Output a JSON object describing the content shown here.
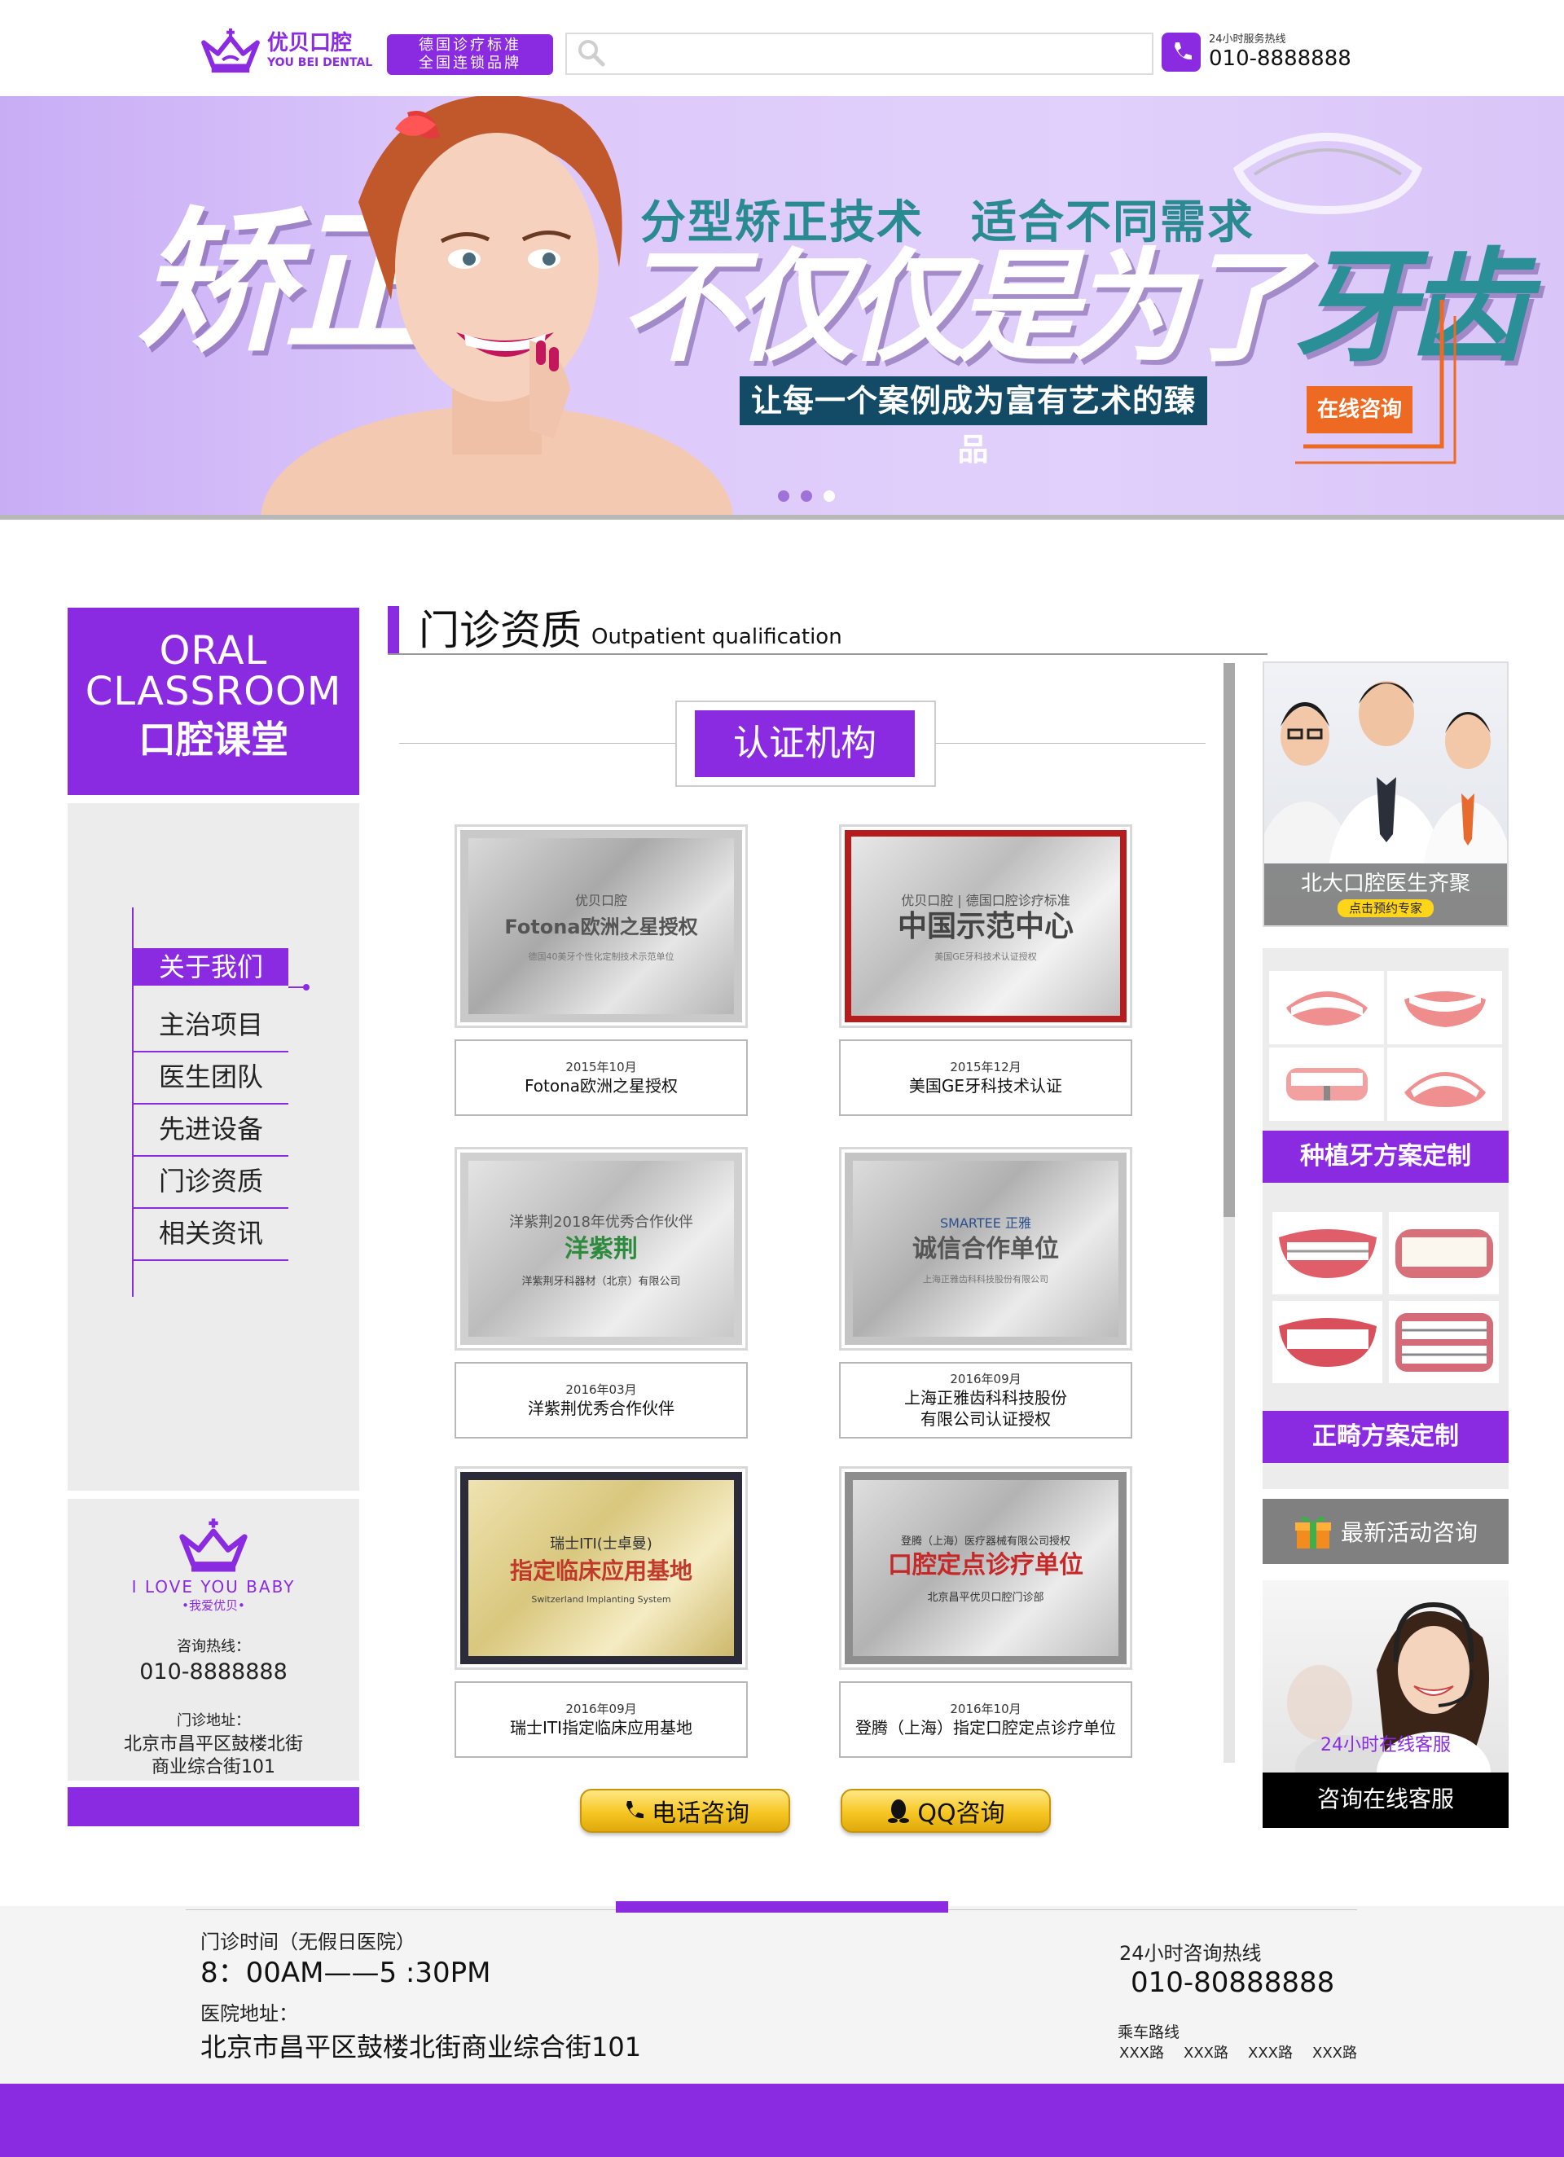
{
  "brand": {
    "name_cn": "优贝口腔",
    "name_en": "YOU BEI DENTAL",
    "slogan_line1": "德国诊疗标准",
    "slogan_line2": "全国连锁品牌",
    "accent_color": "#8a2be2"
  },
  "search": {
    "placeholder": "",
    "value": ""
  },
  "hotline": {
    "label": "24小时服务热线",
    "number": "010-8888888"
  },
  "banner": {
    "big_word": "矫正",
    "subtitle": "分型矫正技术　适合不同需求",
    "headline_part1": "不仅仅是为了",
    "headline_part2": "牙齿",
    "tagline": "让每一个案例成为富有艺术的臻品",
    "cta": "在线咨询",
    "slides": 3,
    "active_slide": 1
  },
  "sidebar": {
    "title_en_1": "ORAL",
    "title_en_2": "CLASSROOM",
    "title_cn": "口腔课堂",
    "nav": [
      {
        "label": "关于我们",
        "active": true
      },
      {
        "label": "主治项目",
        "active": false
      },
      {
        "label": "医生团队",
        "active": false
      },
      {
        "label": "先进设备",
        "active": false
      },
      {
        "label": "门诊资质",
        "active": false
      },
      {
        "label": "相关资讯",
        "active": false
      }
    ],
    "contact": {
      "slogan_en": "I LOVE YOU BABY",
      "slogan_cn": "•我爱优贝•",
      "phone_label": "咨询热线：",
      "phone": "010-8888888",
      "address_label": "门诊地址：",
      "address_line1": "北京市昌平区鼓楼北街",
      "address_line2": "商业综合街101"
    }
  },
  "section": {
    "title_cn": "门诊资质",
    "title_en": "Outpatient qualification",
    "cert_button": "认证机构"
  },
  "certificates": [
    {
      "date": "2015年10月",
      "caption": "Fotona欧洲之星授权",
      "caption2": "",
      "plaque_brand": "优贝口腔",
      "plaque_title": "Fotona欧洲之星授权",
      "plaque_sub": "德国40美牙个性化定制技术示范单位",
      "style": "silver"
    },
    {
      "date": "2015年12月",
      "caption": "美国GE牙科技术认证",
      "caption2": "",
      "plaque_brand": "优贝口腔 | 德国口腔诊疗标准",
      "plaque_title": "中国示范中心",
      "plaque_sub": "美国GE牙科技术认证授权",
      "style": "red"
    },
    {
      "date": "2016年03月",
      "caption": "洋紫荆优秀合作伙伴",
      "caption2": "",
      "plaque_brand": "洋紫荆2018年优秀合作伙伴",
      "plaque_title": "洋紫荆",
      "plaque_sub": "洋紫荆牙科器材（北京）有限公司",
      "style": "silver"
    },
    {
      "date": "2016年09月",
      "caption": "上海正雅齿科科技股份",
      "caption2": "有限公司认证授权",
      "plaque_brand": "SMARTEE 正雅",
      "plaque_title": "诚信合作单位",
      "plaque_sub": "上海正雅齿科科技股份有限公司",
      "style": "silver"
    },
    {
      "date": "2016年09月",
      "caption": "瑞士ITI指定临床应用基地",
      "caption2": "",
      "plaque_brand": "瑞士ITI(士卓曼)",
      "plaque_title": "指定临床应用基地",
      "plaque_sub": "Switzerland Implanting System",
      "style": "gold"
    },
    {
      "date": "2016年10月",
      "caption": "登腾（上海）指定口腔定点诊疗单位",
      "caption2": "",
      "plaque_brand": "登腾（上海）医疗器械有限公司授权",
      "plaque_title": "口腔定点诊疗单位",
      "plaque_sub": "北京昌平优贝口腔门诊部",
      "style": "silver-red"
    }
  ],
  "consult": {
    "phone_label": "电话咨询",
    "qq_label": "QQ咨询"
  },
  "right": {
    "doctors_caption": "北大口腔医生齐聚",
    "doctors_button": "点击预约专家",
    "implant_label": "种植牙方案定制",
    "braces_label": "正畸方案定制",
    "activity_label": "最新活动咨询",
    "service_24": "24小时在线客服",
    "service_label": "咨询在线客服"
  },
  "footer": {
    "hours_label": "门诊时间（无假日医院）",
    "hours": "8：00AM——5 :30PM",
    "address_label": "医院地址：",
    "address": "北京市昌平区鼓楼北街商业综合街101",
    "hotline_label": "24小时咨询热线",
    "hotline": "010-80888888",
    "route_label": "乘车路线",
    "routes": [
      "XXX路",
      "XXX路",
      "XXX路",
      "XXX路"
    ]
  }
}
